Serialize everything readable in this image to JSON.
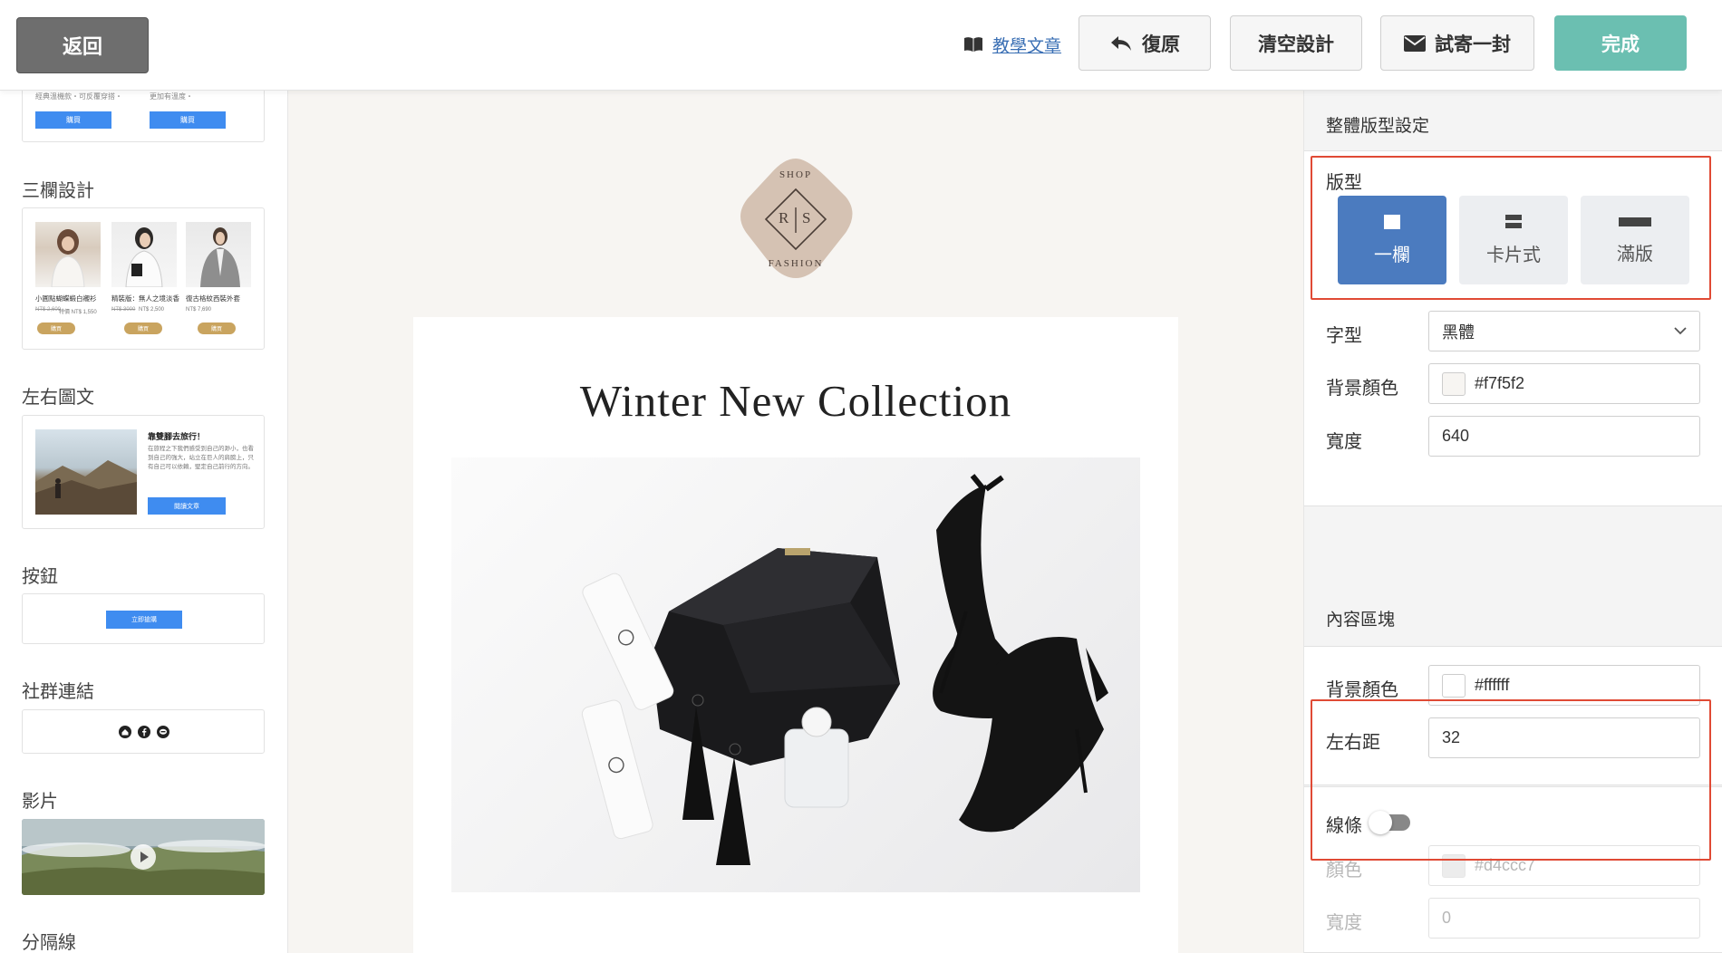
{
  "toolbar": {
    "back_label": "返回",
    "tutorial_label": "教學文章",
    "undo_label": "復原",
    "clear_label": "清空設計",
    "test_send_label": "試寄一封",
    "done_label": "完成"
  },
  "sidebar": {
    "top_card": {
      "desc_left": "經典溫機款・可反覆穿搭・",
      "desc_right": "更加有溫度・",
      "button": "購買"
    },
    "three_col": {
      "title": "三欄設計",
      "items": [
        {
          "name": "小圓點蝴蝶緞白襯衫",
          "old_price": "NT$ 2,600",
          "price": "特價 NT$ 1,550",
          "button": "購買"
        },
        {
          "name": "精裝版：無人之境淡香",
          "old_price": "NT$ 3000",
          "price": "NT$ 2,500",
          "button": "購買"
        },
        {
          "name": "復古格紋西裝外套",
          "old_price": "",
          "price": "NT$ 7,690",
          "button": "購買"
        }
      ]
    },
    "left_right": {
      "title": "左右圖文",
      "heading": "靠雙腳去旅行！",
      "body": "在旅程之下我們感受到自己的渺小，也看到自己的強大，站立在巨人的肩膀上，只有自己可以依賴，堅定自己前行的方向。",
      "button": "閱讀文章"
    },
    "button_section": {
      "title": "按鈕",
      "button": "立即搶購"
    },
    "social": {
      "title": "社群連結"
    },
    "video": {
      "title": "影片"
    },
    "divider": {
      "title": "分隔線"
    }
  },
  "email": {
    "logo": {
      "top": "SHOP",
      "left": "R",
      "right": "S",
      "bottom": "FASHION"
    },
    "title": "Winter New Collection",
    "colors": {
      "background": "#f7f5f2",
      "content": "#ffffff",
      "logo_bg": "#d5c2b3"
    }
  },
  "panel": {
    "global_title": "整體版型設定",
    "layout": {
      "label": "版型",
      "options": [
        {
          "label": "一欄",
          "selected": true
        },
        {
          "label": "卡片式",
          "selected": false
        },
        {
          "label": "滿版",
          "selected": false
        }
      ]
    },
    "font": {
      "label": "字型",
      "value": "黑體"
    },
    "bg_color": {
      "label": "背景顏色",
      "value": "#f7f5f2"
    },
    "width": {
      "label": "寬度",
      "value": "640"
    },
    "content_title": "內容區塊",
    "content_bg": {
      "label": "背景顏色",
      "value": "#ffffff"
    },
    "padding": {
      "label": "左右距",
      "value": "32"
    },
    "line": {
      "label": "線條",
      "enabled": false,
      "color_label": "顏色",
      "color_value": "#d4ccc7",
      "width_label": "寬度",
      "width_value": "0"
    }
  },
  "colors": {
    "accent_blue": "#4b7bbf",
    "done_green": "#6bbfb1",
    "highlight_red": "#e04a35",
    "gold": "#c9a45f"
  }
}
